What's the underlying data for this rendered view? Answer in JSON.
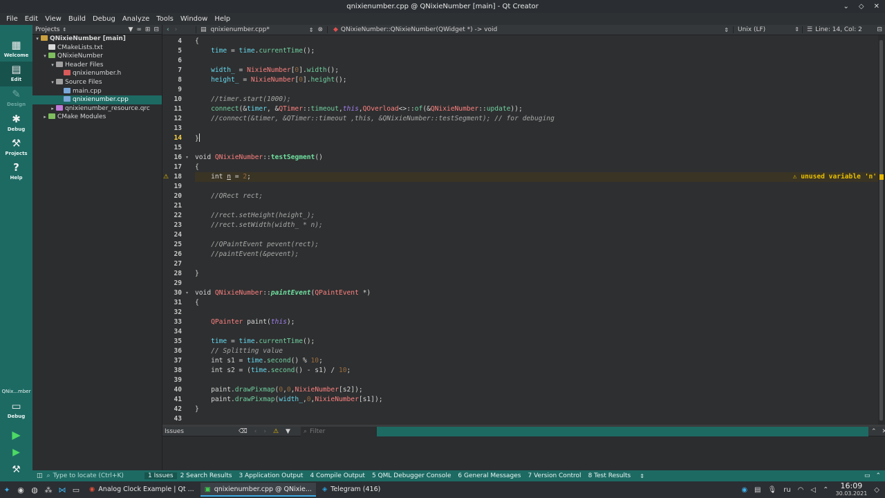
{
  "window": {
    "title": "qnixienumber.cpp @ QNixieNumber [main] - Qt Creator",
    "controls": [
      "⌄",
      "◇",
      "✕"
    ]
  },
  "menubar": [
    "File",
    "Edit",
    "View",
    "Build",
    "Debug",
    "Analyze",
    "Tools",
    "Window",
    "Help"
  ],
  "modes": [
    {
      "label": "Welcome",
      "icon": "grid-icon"
    },
    {
      "label": "Edit",
      "icon": "edit-icon"
    },
    {
      "label": "Design",
      "icon": "design-icon"
    },
    {
      "label": "Debug",
      "icon": "bug-icon"
    },
    {
      "label": "Projects",
      "icon": "wrench-icon"
    },
    {
      "label": "Help",
      "icon": "help-icon"
    }
  ],
  "kit": {
    "name": "QNix...mber",
    "mode": "Debug"
  },
  "projects": {
    "header": "Projects",
    "tree": [
      {
        "label": "QNixieNumber [main]",
        "depth": 0,
        "arrow": "▾",
        "icon": "project-icon",
        "bold": true
      },
      {
        "label": "CMakeLists.txt",
        "depth": 1,
        "arrow": "",
        "icon": "cmake-file-icon"
      },
      {
        "label": "QNixieNumber",
        "depth": 1,
        "arrow": "▾",
        "icon": "target-icon"
      },
      {
        "label": "Header Files",
        "depth": 2,
        "arrow": "▾",
        "icon": "folder-icon"
      },
      {
        "label": "qnixienumber.h",
        "depth": 3,
        "arrow": "",
        "icon": "header-file-icon"
      },
      {
        "label": "Source Files",
        "depth": 2,
        "arrow": "▾",
        "icon": "folder-icon"
      },
      {
        "label": "main.cpp",
        "depth": 3,
        "arrow": "",
        "icon": "cpp-file-icon"
      },
      {
        "label": "qnixienumber.cpp",
        "depth": 3,
        "arrow": "",
        "icon": "cpp-file-icon",
        "selected": true
      },
      {
        "label": "qnixienumber_resource.qrc",
        "depth": 2,
        "arrow": "▸",
        "icon": "qrc-file-icon"
      },
      {
        "label": "CMake Modules",
        "depth": 1,
        "arrow": "▸",
        "icon": "cmake-modules-icon"
      }
    ]
  },
  "editor": {
    "file_tab": "qnixienumber.cpp*",
    "symbol": "QNixieNumber::QNixieNumber(QWidget *) -> void",
    "line_ending": "Unix (LF)",
    "position": "Line: 14, Col: 2",
    "warning": "unused variable 'n'"
  },
  "code_lines": [
    {
      "n": "4",
      "fold": "",
      "html": "<span class=\"kw\">{</span>"
    },
    {
      "n": "5",
      "fold": "",
      "html": "    <span class=\"mem\">time</span> = <span class=\"mem\">time</span>.<span class=\"fn\">currentTime</span>();"
    },
    {
      "n": "6",
      "fold": "",
      "html": ""
    },
    {
      "n": "7",
      "fold": "",
      "html": "    <span class=\"mem\">width_</span> = <span class=\"ty\">NixieNumber</span>[<span class=\"num\">0</span>].<span class=\"fn\">width</span>();"
    },
    {
      "n": "8",
      "fold": "",
      "html": "    <span class=\"mem\">height_</span> = <span class=\"ty\">NixieNumber</span>[<span class=\"num\">0</span>].<span class=\"fn\">height</span>();"
    },
    {
      "n": "9",
      "fold": "",
      "html": ""
    },
    {
      "n": "10",
      "fold": "",
      "html": "    <span class=\"cm\">//timer.start(1000);</span>"
    },
    {
      "n": "11",
      "fold": "",
      "html": "    <span class=\"fn\">connect</span>(&amp;<span class=\"mem\">timer</span>, &amp;<span class=\"ty\">QTimer</span>::<span class=\"fn\">timeout</span>,<span class=\"it\">this</span>,<span class=\"ty\">QOverload</span>&lt;&gt;::<span class=\"fn\">of</span>(&amp;<span class=\"ty\">QNixieNumber</span>::<span class=\"fn\">update</span>));"
    },
    {
      "n": "12",
      "fold": "",
      "html": "    <span class=\"cm\">//connect(&amp;timer, &amp;QTimer::timeout ,this, &amp;QNixieNumber::testSegment); // for debuging</span>"
    },
    {
      "n": "13",
      "fold": "",
      "html": ""
    },
    {
      "n": "14",
      "fold": "",
      "cur": true,
      "html": "<span class=\"kw\">}</span>"
    },
    {
      "n": "15",
      "fold": "",
      "html": ""
    },
    {
      "n": "16",
      "fold": "▾",
      "html": "<span class=\"kw\">void</span> <span class=\"ty\">QNixieNumber</span>::<span class=\"fnb\">testSegment</span>()"
    },
    {
      "n": "17",
      "fold": "",
      "html": "<span class=\"kw\">{</span>"
    },
    {
      "n": "18",
      "fold": "",
      "warn": true,
      "html": "    <span class=\"kw\">int</span> <span class=\"kw\" style=\"text-decoration:underline\">n</span> = <span class=\"num\">2</span>;"
    },
    {
      "n": "19",
      "fold": "",
      "html": ""
    },
    {
      "n": "20",
      "fold": "",
      "html": "    <span class=\"cm\">//QRect rect;</span>"
    },
    {
      "n": "21",
      "fold": "",
      "html": ""
    },
    {
      "n": "22",
      "fold": "",
      "html": "    <span class=\"cm\">//rect.setHeight(height_);</span>"
    },
    {
      "n": "23",
      "fold": "",
      "html": "    <span class=\"cm\">//rect.setWidth(width_ * n);</span>"
    },
    {
      "n": "24",
      "fold": "",
      "html": ""
    },
    {
      "n": "25",
      "fold": "",
      "html": "    <span class=\"cm\">//QPaintEvent pevent(rect);</span>"
    },
    {
      "n": "26",
      "fold": "",
      "html": "    <span class=\"cm\">//paintEvent(&amp;pevent);</span>"
    },
    {
      "n": "27",
      "fold": "",
      "html": ""
    },
    {
      "n": "28",
      "fold": "",
      "html": "<span class=\"kw\">}</span>"
    },
    {
      "n": "29",
      "fold": "",
      "html": ""
    },
    {
      "n": "30",
      "fold": "▾",
      "html": "<span class=\"kw\">void</span> <span class=\"ty\">QNixieNumber</span>::<span class=\"fnbi\">paintEvent</span>(<span class=\"ty\">QPaintEvent</span> *)"
    },
    {
      "n": "31",
      "fold": "",
      "html": "<span class=\"kw\">{</span>"
    },
    {
      "n": "32",
      "fold": "",
      "html": ""
    },
    {
      "n": "33",
      "fold": "",
      "html": "    <span class=\"ty\">QPainter</span> <span class=\"kw\">paint</span>(<span class=\"it\">this</span>);"
    },
    {
      "n": "34",
      "fold": "",
      "html": ""
    },
    {
      "n": "35",
      "fold": "",
      "html": "    <span class=\"mem\">time</span> = <span class=\"mem\">time</span>.<span class=\"fn\">currentTime</span>();"
    },
    {
      "n": "36",
      "fold": "",
      "html": "    <span class=\"cm\">// Splitting value</span>"
    },
    {
      "n": "37",
      "fold": "",
      "html": "    <span class=\"kw\">int</span> s1 = <span class=\"mem\">time</span>.<span class=\"fn\">second</span>() % <span class=\"num\">10</span>;"
    },
    {
      "n": "38",
      "fold": "",
      "html": "    <span class=\"kw\">int</span> s2 = (<span class=\"mem\">time</span>.<span class=\"fn\">second</span>() - s1) / <span class=\"num\">10</span>;"
    },
    {
      "n": "39",
      "fold": "",
      "html": ""
    },
    {
      "n": "40",
      "fold": "",
      "html": "    paint.<span class=\"fn\">drawPixmap</span>(<span class=\"num\">0</span>,<span class=\"num\">0</span>,<span class=\"ty\">NixieNumber</span>[s2]);"
    },
    {
      "n": "41",
      "fold": "",
      "html": "    paint.<span class=\"fn\">drawPixmap</span>(<span class=\"mem\">width_</span>,<span class=\"num\">0</span>,<span class=\"ty\">NixieNumber</span>[s1]);"
    },
    {
      "n": "42",
      "fold": "",
      "html": "<span class=\"kw\">}</span>"
    },
    {
      "n": "43",
      "fold": "",
      "html": ""
    }
  ],
  "issues": {
    "title": "Issues",
    "filter_placeholder": "Filter"
  },
  "locator": {
    "placeholder": "Type to locate (Ctrl+K)"
  },
  "output_tabs": [
    "1 Issues",
    "2 Search Results",
    "3 Application Output",
    "4 Compile Output",
    "5 QML Debugger Console",
    "6 General Messages",
    "7 Version Control",
    "8 Test Results"
  ],
  "taskbar": {
    "tasks": [
      {
        "label": "Analog Clock Example | Qt ...",
        "icon": "browser-icon"
      },
      {
        "label": "qnixienumber.cpp @ QNixie...",
        "icon": "qtcreator-icon",
        "active": true
      },
      {
        "label": "Telegram (416)",
        "icon": "telegram-icon"
      }
    ],
    "lang": "ru",
    "time": "16:09",
    "date": "30.03.2021"
  },
  "colors": {
    "accent": "#1d6a63",
    "editor_bg": "#2e2f30",
    "warning": "#e8c000"
  }
}
